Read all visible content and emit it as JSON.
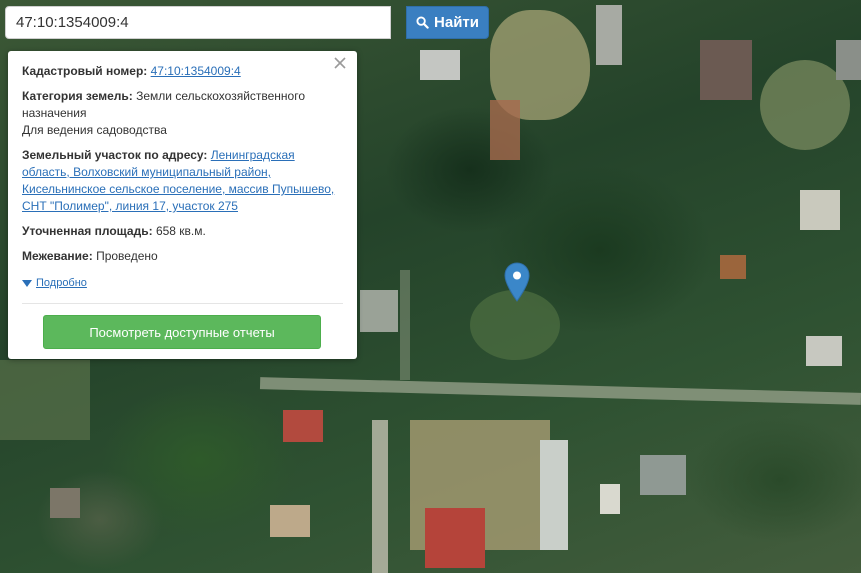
{
  "search": {
    "value": "47:10:1354009:4",
    "button_label": "Найти"
  },
  "popup": {
    "cadastral_label": "Кадастровый номер:",
    "cadastral_value": "47:10:1354009:4",
    "category_label": "Категория земель:",
    "category_value": "Земли сельскохозяйственного назначения",
    "category_use": "Для ведения садоводства",
    "address_label": "Земельный участок по адресу:",
    "address_value": "Ленинградская область, Волховский муниципальный район, Кисельнинское сельское поселение, массив Пупышево, СНТ \"Полимер\", линия 17, участок 275",
    "area_label": "Уточненная площадь:",
    "area_value": "658 кв.м.",
    "survey_label": "Межевание:",
    "survey_value": "Проведено",
    "details_label": "Подробно",
    "reports_button": "Посмотреть доступные отчеты"
  },
  "colors": {
    "search_button": "#3a7fc1",
    "reports_button": "#5cb85c",
    "link": "#2a6fb8",
    "pin": "#3b87c9"
  },
  "icons": [
    "search-icon",
    "close-icon",
    "caret-down-icon",
    "map-pin-icon"
  ]
}
